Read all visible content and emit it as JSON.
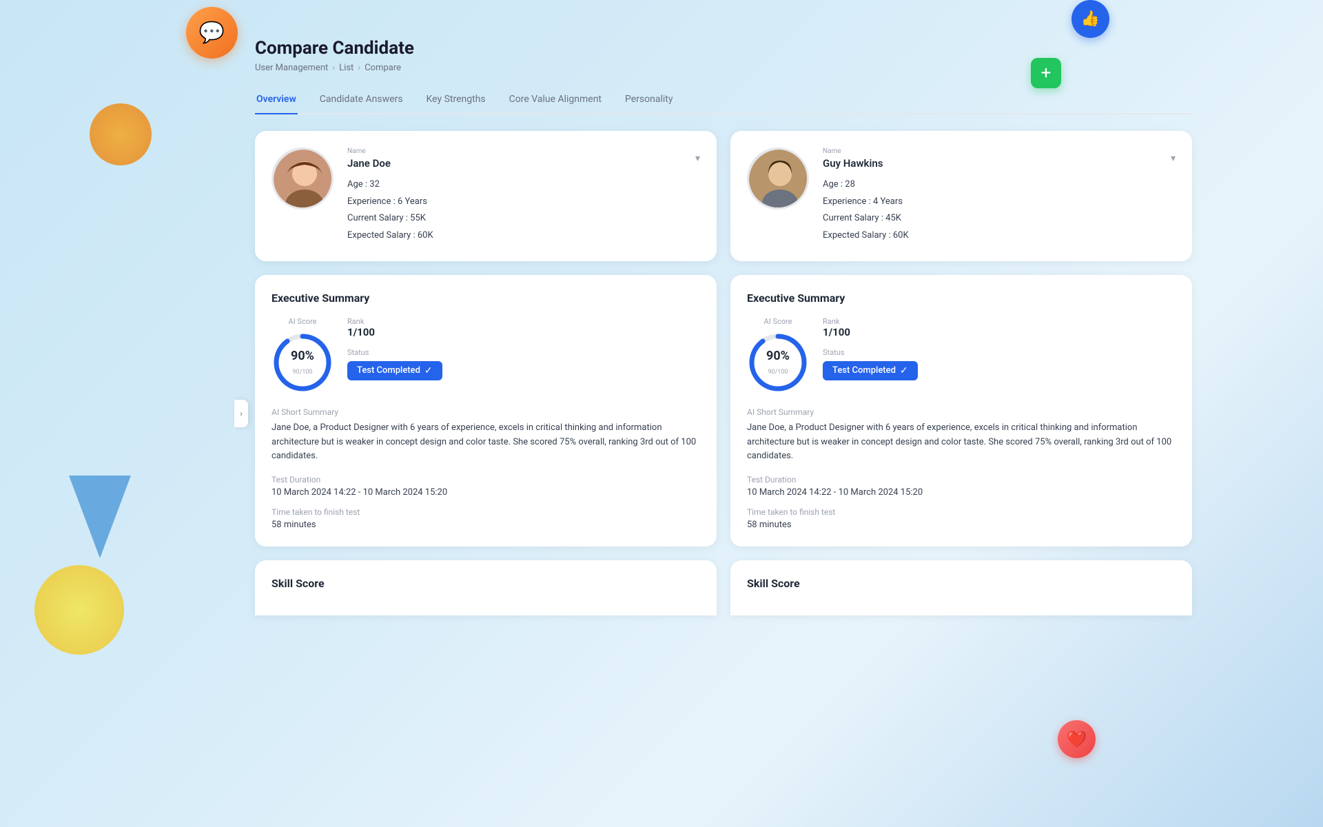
{
  "page": {
    "title": "Compare Candidate",
    "breadcrumb": {
      "items": [
        "User Management",
        "List",
        "Compare"
      ]
    }
  },
  "tabs": [
    {
      "label": "Overview",
      "active": true
    },
    {
      "label": "Candidate Answers",
      "active": false
    },
    {
      "label": "Key Strengths",
      "active": false
    },
    {
      "label": "Core Value Alignment",
      "active": false
    },
    {
      "label": "Personality",
      "active": false
    }
  ],
  "candidates": [
    {
      "name_label": "Name",
      "name": "Jane Doe",
      "age_label": "Age",
      "age": "32",
      "experience_label": "Experience",
      "experience": "6 Years",
      "current_salary_label": "Current Salary",
      "current_salary": "55K",
      "expected_salary_label": "Expected Salary",
      "expected_salary": "60K"
    },
    {
      "name_label": "Name",
      "name": "Guy Hawkins",
      "age_label": "Age",
      "age": "28",
      "experience_label": "Experience",
      "experience": "4 Years",
      "current_salary_label": "Current Salary",
      "current_salary": "45K",
      "expected_salary_label": "Expected Salary",
      "expected_salary": "60K"
    }
  ],
  "executive_summaries": [
    {
      "title": "Executive Summary",
      "ai_score_label": "AI Score",
      "rank_label": "Rank",
      "rank": "1/100",
      "score_pct": "90%",
      "score_sub": "90/100",
      "status_label": "Status",
      "status_text": "Test Completed",
      "summary_label": "AI Short Summary",
      "summary_text": "Jane Doe, a Product Designer with 6 years of experience, excels in critical thinking and information architecture but is weaker in concept design and color taste. She scored 75% overall, ranking 3rd out of 100 candidates.",
      "duration_label": "Test Duration",
      "duration": "10 March 2024 14:22 - 10 March 2024 15:20",
      "time_label": "Time taken to finish test",
      "time": "58 minutes"
    },
    {
      "title": "Executive Summary",
      "ai_score_label": "AI Score",
      "rank_label": "Rank",
      "rank": "1/100",
      "score_pct": "90%",
      "score_sub": "90/100",
      "status_label": "Status",
      "status_text": "Test Completed",
      "summary_label": "AI Short Summary",
      "summary_text": "Jane Doe, a Product Designer with 6 years of experience, excels in critical thinking and information architecture but is weaker in concept design and color taste. She scored 75% overall, ranking 3rd out of 100 candidates.",
      "duration_label": "Test Duration",
      "duration": "10 March 2024 14:22 - 10 March 2024 15:20",
      "time_label": "Time taken to finish test",
      "time": "58 minutes"
    }
  ],
  "skill_sections": [
    {
      "title": "Skill Score"
    },
    {
      "title": "Skill Score"
    }
  ],
  "icons": {
    "chat": "💬",
    "plus": "+",
    "heart": "❤️",
    "thumb": "👍",
    "chevron_down": "▾",
    "check": "✓",
    "arrow_right": "›"
  },
  "colors": {
    "accent": "#2563eb",
    "green": "#22c55e",
    "red": "#ef4444",
    "score_track": "#e5e7eb",
    "score_fill": "#2563eb"
  }
}
